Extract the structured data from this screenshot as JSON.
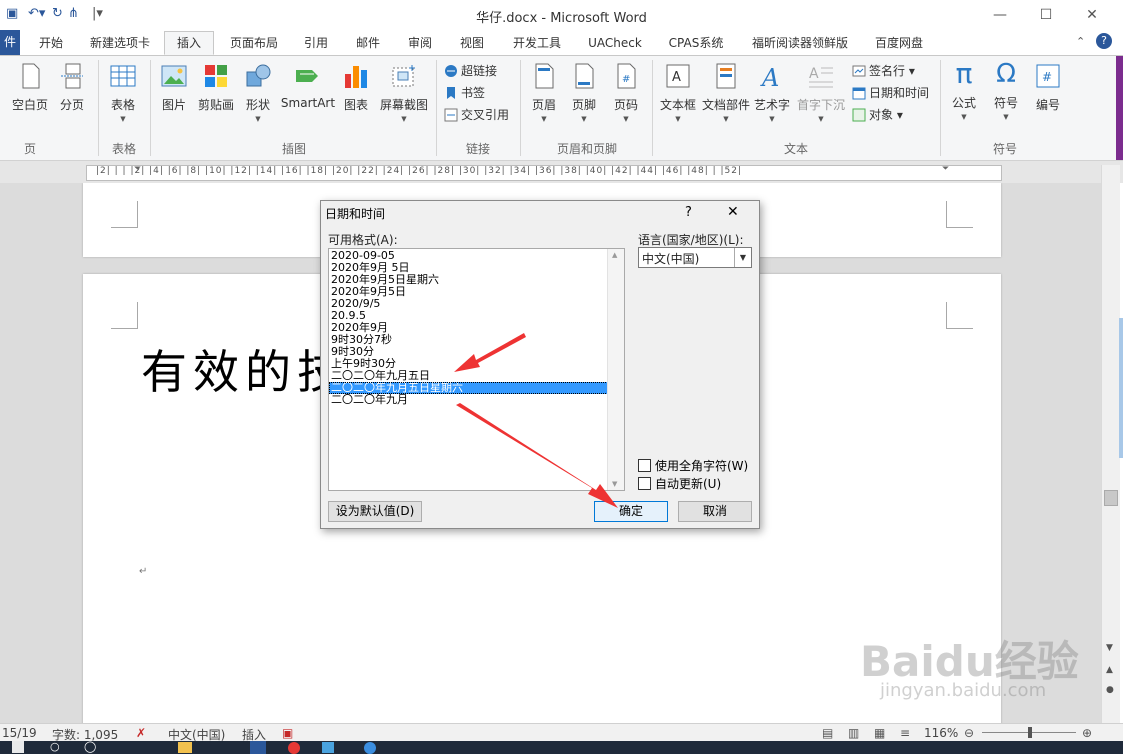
{
  "window": {
    "title": "华仔.docx - Microsoft Word",
    "controls": {
      "minimize": "—",
      "maximize": "☐",
      "close": "✕"
    }
  },
  "ribbon_tabs": [
    "开始",
    "新建选项卡",
    "插入",
    "页面布局",
    "引用",
    "邮件",
    "审阅",
    "视图",
    "开发工具",
    "UACheck",
    "CPAS系统",
    "福昕阅读器领鲜版",
    "百度网盘"
  ],
  "active_tab": "插入",
  "file_tab_label": "件",
  "ribbon": {
    "groups": {
      "pages": "页",
      "tables": "表格",
      "illustrations": "插图",
      "links": "链接",
      "header_footer": "页眉和页脚",
      "text": "文本",
      "symbols": "符号"
    },
    "buttons": {
      "blank_page": "空白页",
      "page_break": "分页",
      "table": "表格",
      "picture": "图片",
      "clipart": "剪贴画",
      "shapes": "形状",
      "smartart": "SmartArt",
      "chart": "图表",
      "screenshot": "屏幕截图",
      "hyperlink": "超链接",
      "bookmark": "书签",
      "cross_ref": "交叉引用",
      "header": "页眉",
      "footer": "页脚",
      "page_number": "页码",
      "textbox": "文本框",
      "quick_parts": "文档部件",
      "wordart": "艺术字",
      "drop_cap": "首字下沉",
      "signature_line": "签名行",
      "date_time": "日期和时间",
      "object": "对象",
      "equation": "公式",
      "symbol": "符号",
      "number": "编号"
    }
  },
  "ruler_numbers": "|2|  |  |  |2|  |4|  |6|  |8|  |10|  |12|  |14|  |16|  |18|  |20|  |22|  |24|  |26|  |28|  |30|  |32|  |34|  |36|  |38|  |40|  |42|  |44|  |46|  |48|  |  |52|",
  "document": {
    "heading_text": "有效的技"
  },
  "dialog": {
    "title": "日期和时间",
    "help": "?",
    "close": "✕",
    "formats_label": "可用格式(A):",
    "formats": [
      "2020-09-05",
      "2020年9月 5日",
      "2020年9月5日星期六",
      "2020年9月5日",
      "2020/9/5",
      "20.9.5",
      "2020年9月",
      "9时30分7秒",
      "9时30分",
      "上午9时30分",
      "二〇二〇年九月五日",
      "二〇二〇年九月五日星期六",
      "二〇二〇年九月"
    ],
    "selected_index": 11,
    "language_label": "语言(国家/地区)(L):",
    "language_value": "中文(中国)",
    "fullwidth_label": "使用全角字符(W)",
    "autoupdate_label": "自动更新(U)",
    "set_default_label": "设为默认值(D)",
    "ok_label": "确定",
    "cancel_label": "取消"
  },
  "status_bar": {
    "page": "15/19",
    "words": "字数: 1,095",
    "language": "中文(中国)",
    "insert_mode": "插入",
    "zoom": "116%"
  },
  "watermark": {
    "text": "Baidu经验",
    "url": "jingyan.baidu.com"
  },
  "colors": {
    "accent": "#2b579a",
    "selection": "#3399ff",
    "arrow": "#ee3333"
  }
}
